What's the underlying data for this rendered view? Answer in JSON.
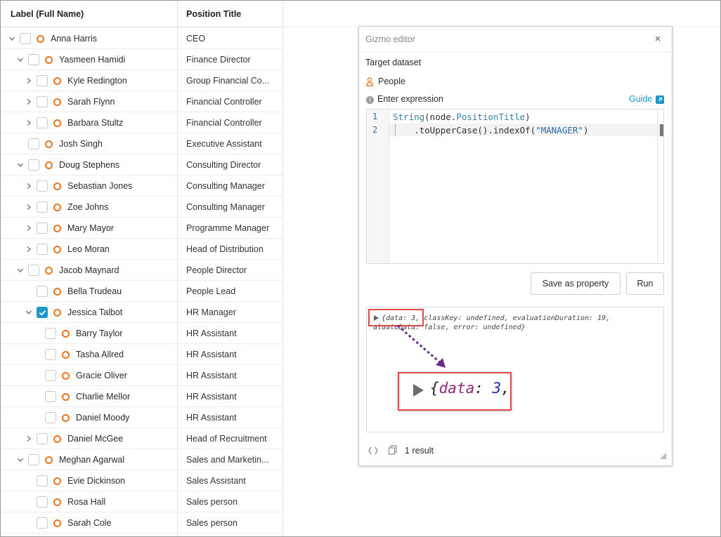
{
  "grid": {
    "columns": [
      "Label (Full Name)",
      "Position Title"
    ],
    "rows": [
      {
        "name": "Anna Harris",
        "position": "CEO",
        "level": 0,
        "expander": "open",
        "checked": false
      },
      {
        "name": "Yasmeen Hamidi",
        "position": "Finance Director",
        "level": 1,
        "expander": "open",
        "checked": false
      },
      {
        "name": "Kyle Redington",
        "position": "Group Financial Co...",
        "level": 2,
        "expander": "closed",
        "checked": false
      },
      {
        "name": "Sarah Flynn",
        "position": "Financial Controller",
        "level": 2,
        "expander": "closed",
        "checked": false
      },
      {
        "name": "Barbara Stultz",
        "position": "Financial Controller",
        "level": 2,
        "expander": "closed",
        "checked": false
      },
      {
        "name": "Josh Singh",
        "position": "Executive Assistant",
        "level": 1,
        "expander": "none",
        "checked": false
      },
      {
        "name": "Doug Stephens",
        "position": "Consulting Director",
        "level": 1,
        "expander": "open",
        "checked": false
      },
      {
        "name": "Sebastian Jones",
        "position": "Consulting Manager",
        "level": 2,
        "expander": "closed",
        "checked": false
      },
      {
        "name": "Zoe Johns",
        "position": "Consulting Manager",
        "level": 2,
        "expander": "closed",
        "checked": false
      },
      {
        "name": "Mary Mayor",
        "position": "Programme Manager",
        "level": 2,
        "expander": "closed",
        "checked": false
      },
      {
        "name": "Leo Moran",
        "position": "Head of Distribution",
        "level": 2,
        "expander": "closed",
        "checked": false
      },
      {
        "name": "Jacob Maynard",
        "position": "People Director",
        "level": 1,
        "expander": "open",
        "checked": false
      },
      {
        "name": "Bella Trudeau",
        "position": "People Lead",
        "level": 2,
        "expander": "none",
        "checked": false
      },
      {
        "name": "Jessica Talbot",
        "position": "HR Manager",
        "level": 2,
        "expander": "open",
        "checked": true
      },
      {
        "name": "Barry Taylor",
        "position": "HR Assistant",
        "level": 3,
        "expander": "none",
        "checked": false
      },
      {
        "name": "Tasha Allred",
        "position": "HR Assistant",
        "level": 3,
        "expander": "none",
        "checked": false
      },
      {
        "name": "Gracie Oliver",
        "position": "HR Assistant",
        "level": 3,
        "expander": "none",
        "checked": false
      },
      {
        "name": "Charlie Mellor",
        "position": "HR Assistant",
        "level": 3,
        "expander": "none",
        "checked": false
      },
      {
        "name": "Daniel Moody",
        "position": "HR Assistant",
        "level": 3,
        "expander": "none",
        "checked": false
      },
      {
        "name": "Daniel McGee",
        "position": "Head of Recruitment",
        "level": 2,
        "expander": "closed",
        "checked": false
      },
      {
        "name": "Meghan Agarwal",
        "position": "Sales and Marketin...",
        "level": 1,
        "expander": "open",
        "checked": false
      },
      {
        "name": "Evie Dickinson",
        "position": "Sales Assistant",
        "level": 2,
        "expander": "none",
        "checked": false
      },
      {
        "name": "Rosa Hall",
        "position": "Sales person",
        "level": 2,
        "expander": "none",
        "checked": false
      },
      {
        "name": "Sarah Cole",
        "position": "Sales person",
        "level": 2,
        "expander": "none",
        "checked": false
      }
    ]
  },
  "editor": {
    "title": "Gizmo editor",
    "target_label": "Target dataset",
    "dataset": "People",
    "expression_label": "Enter expression",
    "guide_label": "Guide",
    "line_numbers": [
      "1",
      "2"
    ],
    "code_line1": {
      "fn": "String",
      "open": "(node.",
      "prop": "PositionTitle",
      "close": ")"
    },
    "code_line2": {
      "pre": "    .toUpperCase().indexOf(",
      "str": "\"MANAGER\"",
      "post": ")"
    },
    "save_label": "Save as property",
    "run_label": "Run",
    "result_line1": "{data: 3, classKey: undefined, evaluationDuration: 19,",
    "result_line2": "aluateData: false, error: undefined}",
    "zoom": {
      "brace": "{",
      "key": "data",
      "sep": ": ",
      "value": "3",
      "trail": ","
    },
    "result_count": "1 result"
  },
  "colors": {
    "accent": "#1b98c9",
    "node_icon": "#e8761e",
    "highlight": "#e14a4a",
    "arrow": "#6a2a8c"
  }
}
